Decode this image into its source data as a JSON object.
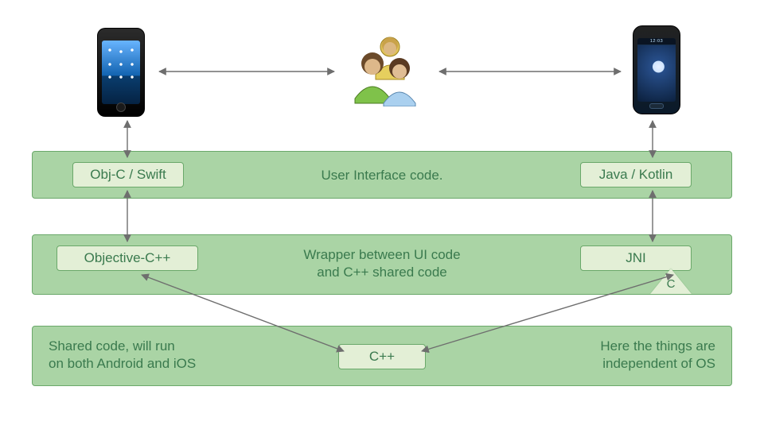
{
  "icons": {
    "left_phone": "iphone-icon",
    "right_phone": "android-phone-icon",
    "people": "users-icon"
  },
  "layer1": {
    "left_box": "Obj-C / Swift",
    "caption": "User Interface code.",
    "right_box": "Java / Kotlin"
  },
  "layer2": {
    "left_box": "Objective-C++",
    "caption_line1": "Wrapper between UI code",
    "caption_line2": "and C++ shared code",
    "right_box": "JNI",
    "triangle_label": "C"
  },
  "layer3": {
    "left_caption_line1": "Shared code, will run",
    "left_caption_line2": "on both Android and iOS",
    "center_box": "C++",
    "right_caption_line1": "Here the things are",
    "right_caption_line2": "independent of OS"
  }
}
